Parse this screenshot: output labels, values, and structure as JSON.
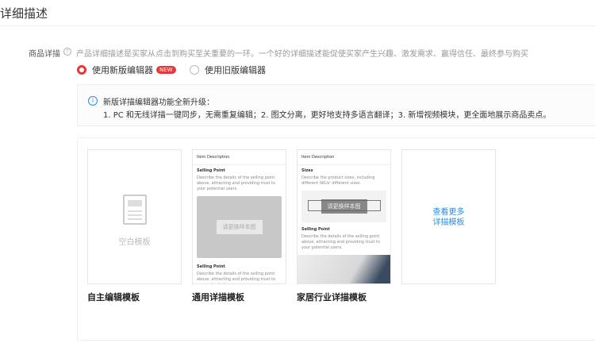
{
  "title": "详细描述",
  "field_label": "商品详描",
  "hint": "产品详细描述是买家从点击到购买至关重要的一环。一个好的详细描述能促使买家产生兴趣、激发需求、赢得信任、最终参与购买",
  "radios": [
    {
      "label": "使用新版编辑器",
      "badge": "NEW",
      "selected": true
    },
    {
      "label": "使用旧版编辑器",
      "selected": false
    }
  ],
  "info": {
    "line1": "新版详描编辑器功能全新升级：",
    "line2": "1. PC 和无线详描一键同步，无需重复编辑；2. 图文分离，更好地支持多语言翻译；3. 新增视频模块，更全面地展示商品卖点。"
  },
  "templates": {
    "blank": {
      "text": "空白模板",
      "caption": "自主编辑模板"
    },
    "general": {
      "header": "Item Description",
      "sp1": "Selling Point",
      "desc": "Describe the details of the selling point above, attracting and providing trust to your potential users.",
      "button": "请更换样本图",
      "sp2": "Selling Point",
      "caption": "通用详描模板"
    },
    "home": {
      "header": "Item Description",
      "sizes": "Sizes",
      "sizes_desc": "Describe the product sizes, including different SKUs' different sizes.",
      "button": "请更换样本图",
      "sp": "Selling Point",
      "desc": "Describe the details of the selling point above, attracting and providing trust to your potential users.",
      "caption": "家居行业详描模板"
    },
    "more": {
      "line1": "查看更多",
      "line2": "详描模板"
    }
  }
}
